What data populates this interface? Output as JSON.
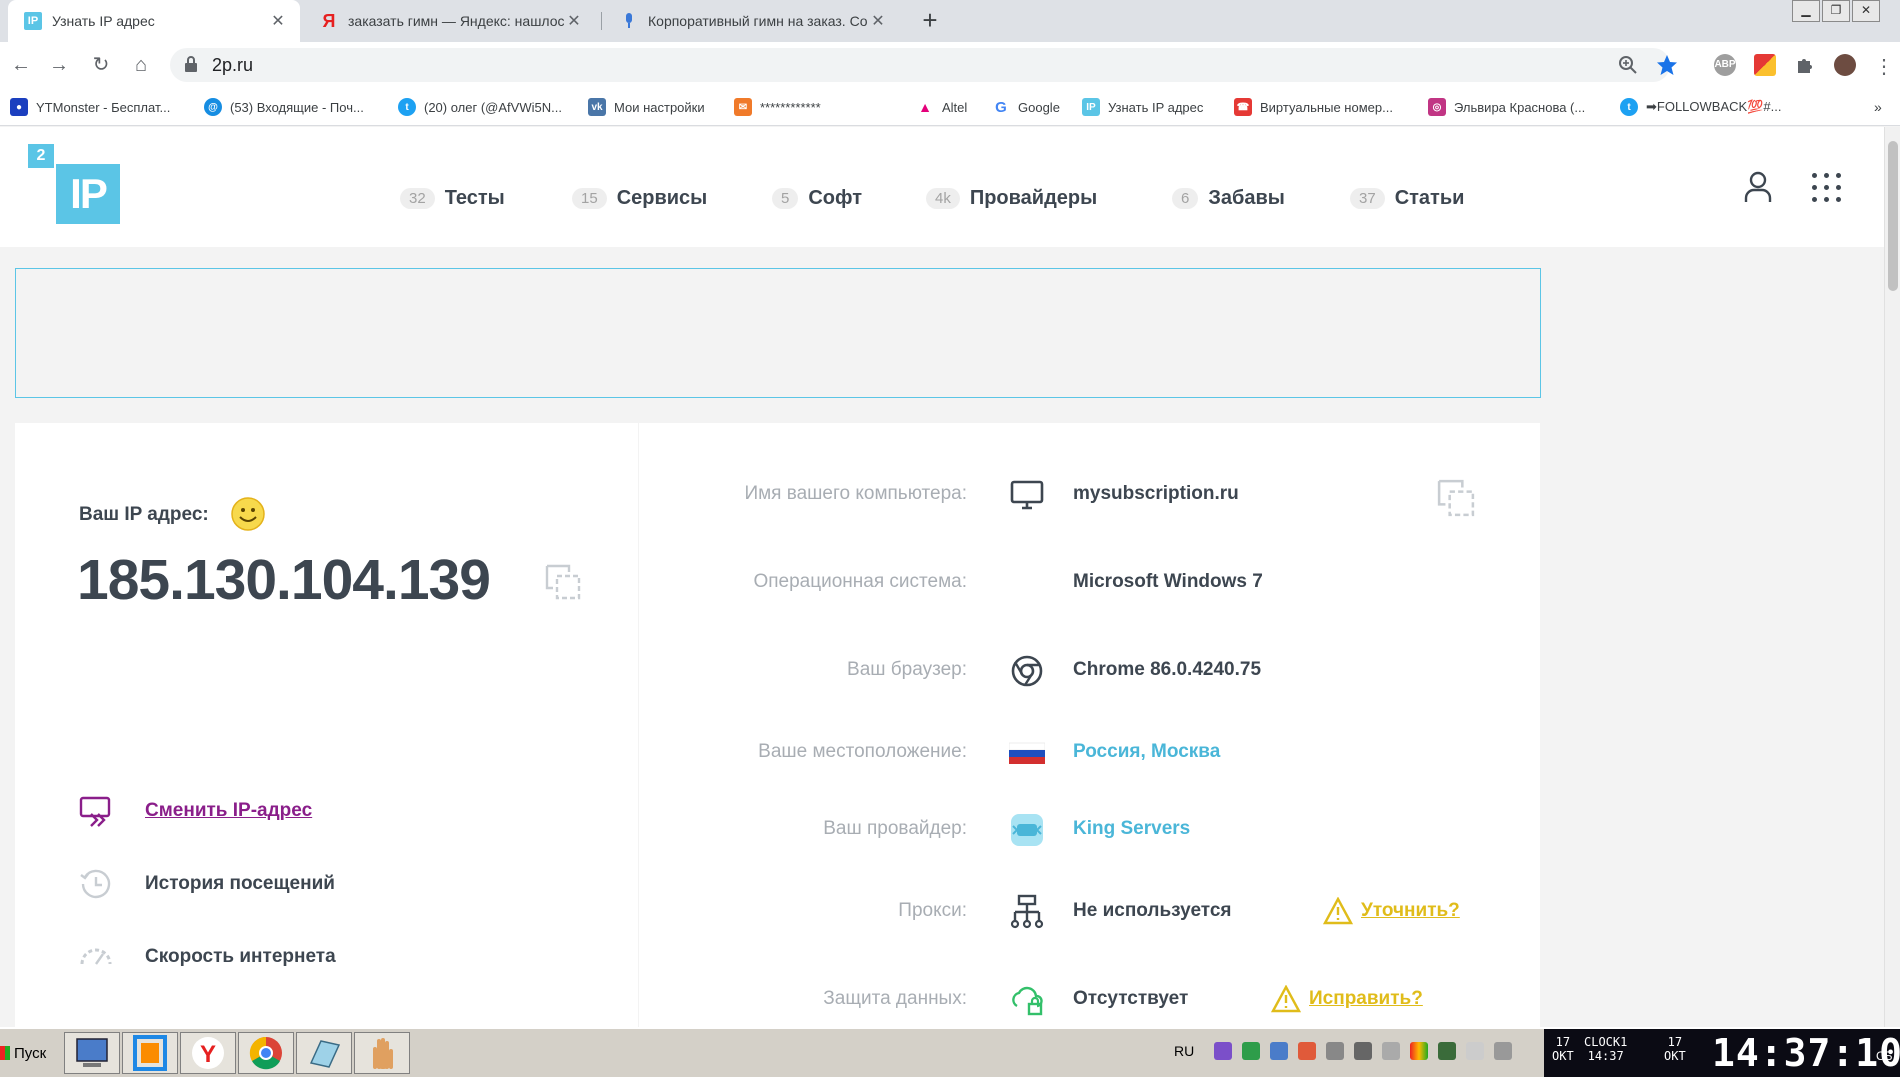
{
  "browser": {
    "tabs": [
      {
        "title": "Узнать IP адрес",
        "active": true
      },
      {
        "title": "заказать гимн — Яндекс: нашлось",
        "active": false
      },
      {
        "title": "Корпоративный гимн на заказ. Со",
        "active": false
      }
    ],
    "url": "2p.ru",
    "ext_abp": "ABP"
  },
  "bookmarks": [
    "YTMonster - Бесплат...",
    "(53) Входящие - Поч...",
    "(20) олег (@AfVWi5N...",
    "Мои настройки",
    "************",
    "Altel",
    "Google",
    "Узнать IP адрес",
    "Виртуальные номер...",
    "Эльвира Краснова (...",
    "➡FOLLOWBACK💯#..."
  ],
  "site": {
    "logo_big": "IP",
    "logo_small": "2",
    "menu": [
      {
        "count": "32",
        "label": "Тесты"
      },
      {
        "count": "15",
        "label": "Сервисы"
      },
      {
        "count": "5",
        "label": "Софт"
      },
      {
        "count": "4k",
        "label": "Провайдеры"
      },
      {
        "count": "6",
        "label": "Забавы"
      },
      {
        "count": "37",
        "label": "Статьи"
      }
    ]
  },
  "ip_card": {
    "label": "Ваш IP адрес:",
    "ip": "185.130.104.139",
    "links": [
      {
        "label": "Сменить IP-адрес"
      },
      {
        "label": "История посещений"
      },
      {
        "label": "Скорость интернета"
      }
    ]
  },
  "info": {
    "rows": [
      {
        "key": "Имя вашего компьютера:",
        "value": "mysubscription.ru",
        "icon": "monitor-icon"
      },
      {
        "key": "Операционная система:",
        "value": "Microsoft Windows 7",
        "icon": ""
      },
      {
        "key": "Ваш браузер:",
        "value": "Chrome 86.0.4240.75",
        "icon": "chrome-icon"
      },
      {
        "key": "Ваше местоположение:",
        "value": "Россия, Москва",
        "icon": "russia-flag-icon"
      },
      {
        "key": "Ваш провайдер:",
        "value": "King Servers",
        "icon": "provider-icon"
      },
      {
        "key": "Прокси:",
        "value": "Не используется",
        "icon": "network-icon",
        "action": "Уточнить?"
      },
      {
        "key": "Защита данных:",
        "value": "Отсутствует",
        "icon": "cloud-lock-icon",
        "action": "Исправить?"
      }
    ]
  },
  "taskbar": {
    "start": "Пуск",
    "lang": "RU",
    "date_day": "17",
    "date_month": "ОКТ",
    "clock_label": "CLOCK1",
    "clock_small": "14:37",
    "time": "14:37:10",
    "weekday": "СБ"
  },
  "colors": {
    "accent": "#5bc5e6",
    "link_purple": "#8a1e8a",
    "warning": "#e0bc1a",
    "text_dark": "#3d4650"
  }
}
